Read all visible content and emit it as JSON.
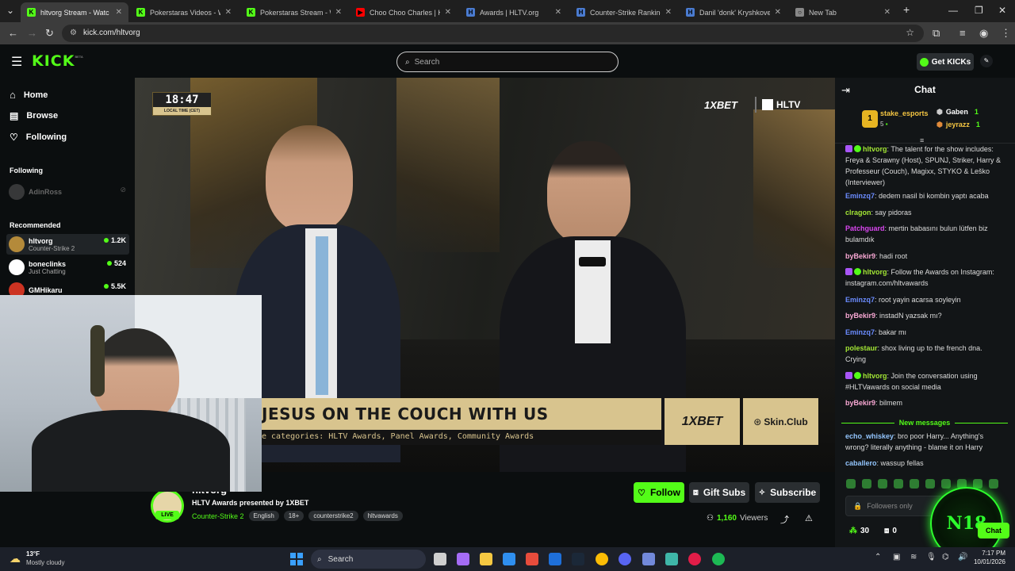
{
  "browser": {
    "tabs": [
      {
        "title": "hltvorg Stream - Watc",
        "color": "#53fc18",
        "glyph": "K"
      },
      {
        "title": "Pokerstaras Videos - Watc",
        "color": "#53fc18",
        "glyph": "K"
      },
      {
        "title": "Pokerstaras Stream - Wat",
        "color": "#53fc18",
        "glyph": "K"
      },
      {
        "title": "Choo Choo Charles | KILL",
        "color": "#ff0000",
        "glyph": "▶"
      },
      {
        "title": "Awards | HLTV.org",
        "color": "#4a7bd0",
        "glyph": "H"
      },
      {
        "title": "Counter-Strike Ranking |",
        "color": "#4a7bd0",
        "glyph": "H"
      },
      {
        "title": "Danil 'donk' Kryshkovets",
        "color": "#4a7bd0",
        "glyph": "H"
      },
      {
        "title": "New Tab",
        "color": "#888888",
        "glyph": "○"
      }
    ],
    "url": "kick.com/hltvorg"
  },
  "kick": {
    "logo": "KICK",
    "logo_beta": "BETA",
    "search_placeholder": "Search",
    "get_kicks": "Get KICKs"
  },
  "sidebar": {
    "nav": [
      {
        "label": "Home",
        "icon": "home-icon"
      },
      {
        "label": "Browse",
        "icon": "browse-icon"
      },
      {
        "label": "Following",
        "icon": "heart-icon"
      }
    ],
    "following_header": "Following",
    "following": [
      {
        "name": "AdinRoss"
      }
    ],
    "recommended_header": "Recommended",
    "recommended": [
      {
        "name": "hltvorg",
        "category": "Counter-Strike 2",
        "viewers": "1.2K",
        "color": "#b48a3a"
      },
      {
        "name": "boneclinks",
        "category": "Just Chatting",
        "viewers": "524",
        "color": "#ffffff"
      },
      {
        "name": "GMHikaru",
        "category": "",
        "viewers": "5.5K",
        "color": "#cc3322"
      }
    ]
  },
  "video": {
    "clock": "18:47",
    "clock_sub": "LOCAL TIME (CET)",
    "sponsor": "1XBET",
    "brand": "HLTV",
    "banner": "JESUS ON THE COUCH WITH US",
    "ticker": "e categories: HLTV Awards, Panel Awards, Community Awards",
    "banner_sponsor_1": "1XBET",
    "banner_sponsor_2": "Skin.Club"
  },
  "stream": {
    "channel": "hltvorg",
    "title": "HLTV Awards presented by 1XBET",
    "category": "Counter-Strike 2",
    "live": "LIVE",
    "tags": [
      "English",
      "18+",
      "counterstrike2",
      "hltvawards"
    ],
    "follow": "Follow",
    "gift": "Gift Subs",
    "subscribe": "Subscribe",
    "viewers_count": "1,160",
    "viewers_label": "Viewers"
  },
  "chat": {
    "title": "Chat",
    "leader_rank": "1",
    "leader_name": "stake_esports",
    "leader_count": "5",
    "top2_name": "Gaben",
    "top2_count": "1",
    "top3_name": "jeyrazz",
    "top3_count": "1",
    "messages": [
      {
        "user": "hltvorg",
        "color": "#a3e635",
        "badges": true,
        "text": "The talent for the show includes: Freya & Scrawny (Host), SPUNJ, Striker, Harry & Professeur (Couch), Magixx, STYKO & Leško (Interviewer)"
      },
      {
        "user": "Eminzq7",
        "color": "#6b8cff",
        "badges": false,
        "text": "dedem nasil bi kombin yaptı acaba"
      },
      {
        "user": "clragon",
        "color": "#a3e635",
        "badges": false,
        "text": "say pidoras"
      },
      {
        "user": "Patchguard",
        "color": "#d946ef",
        "badges": false,
        "text": "mertin babasını bulun lütfen biz bulamdık"
      },
      {
        "user": "byBekir9",
        "color": "#f9a8d4",
        "badges": false,
        "text": "hadi root"
      },
      {
        "user": "hltvorg",
        "color": "#a3e635",
        "badges": true,
        "text": "Follow the Awards on Instagram: instagram.com/hltvawards"
      },
      {
        "user": "Eminzq7",
        "color": "#6b8cff",
        "badges": false,
        "text": "root yayin acarsa soyleyin"
      },
      {
        "user": "byBekir9",
        "color": "#f9a8d4",
        "badges": false,
        "text": "instadN yazsak mı?"
      },
      {
        "user": "Eminzq7",
        "color": "#6b8cff",
        "badges": false,
        "text": "bakar mı"
      },
      {
        "user": "polestaur",
        "color": "#a3e635",
        "badges": false,
        "text": "shox living up to the french dna. Crying"
      },
      {
        "user": "hltvorg",
        "color": "#a3e635",
        "badges": true,
        "text": "Join the conversation using #HLTVawards on social media"
      },
      {
        "user": "byBekir9",
        "color": "#f9a8d4",
        "badges": false,
        "text": "bilmem"
      }
    ],
    "new_messages": "New messages",
    "new": [
      {
        "user": "echo_whiskey",
        "color": "#93c5fd",
        "text": "bro poor Harry... Anything's wrong? literally anything - blame it on Harry"
      },
      {
        "user": "caballero",
        "color": "#93c5fd",
        "text": "wassup fellas"
      }
    ],
    "input_placeholder": "Followers only",
    "points": "30",
    "gifts": "0",
    "send": "Chat"
  },
  "taskbar": {
    "temp": "13°F",
    "weather": "Mostly cloudy",
    "search": "Search",
    "time": "7:17 PM",
    "date": "10/01/2026"
  },
  "overlay": {
    "logo_text": "N18"
  }
}
